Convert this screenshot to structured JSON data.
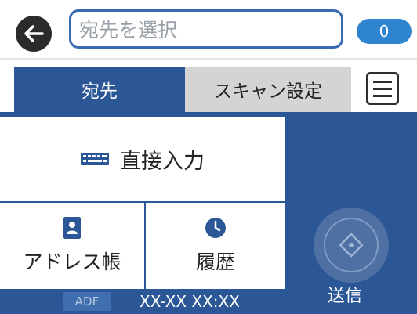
{
  "header": {
    "search_placeholder": "宛先を選択",
    "selected_count": "0"
  },
  "tabs": [
    {
      "label": "宛先",
      "active": true
    },
    {
      "label": "スキャン設定",
      "active": false
    }
  ],
  "options": {
    "direct_input_label": "直接入力",
    "address_book_label": "アドレス帳",
    "history_label": "履歴"
  },
  "status": {
    "source_badge": "ADF",
    "datetime": "XX-XX XX:XX"
  },
  "send": {
    "label": "送信"
  },
  "colors": {
    "primary": "#2c5796",
    "accent": "#2e84cf",
    "tab_inactive": "#d4d4d4"
  },
  "icons": {
    "back": "arrow-left-icon",
    "menu": "hamburger-menu-icon",
    "direct_input": "keyboard-icon",
    "address_book": "address-book-icon",
    "history": "clock-icon",
    "send": "start-diamond-icon"
  }
}
